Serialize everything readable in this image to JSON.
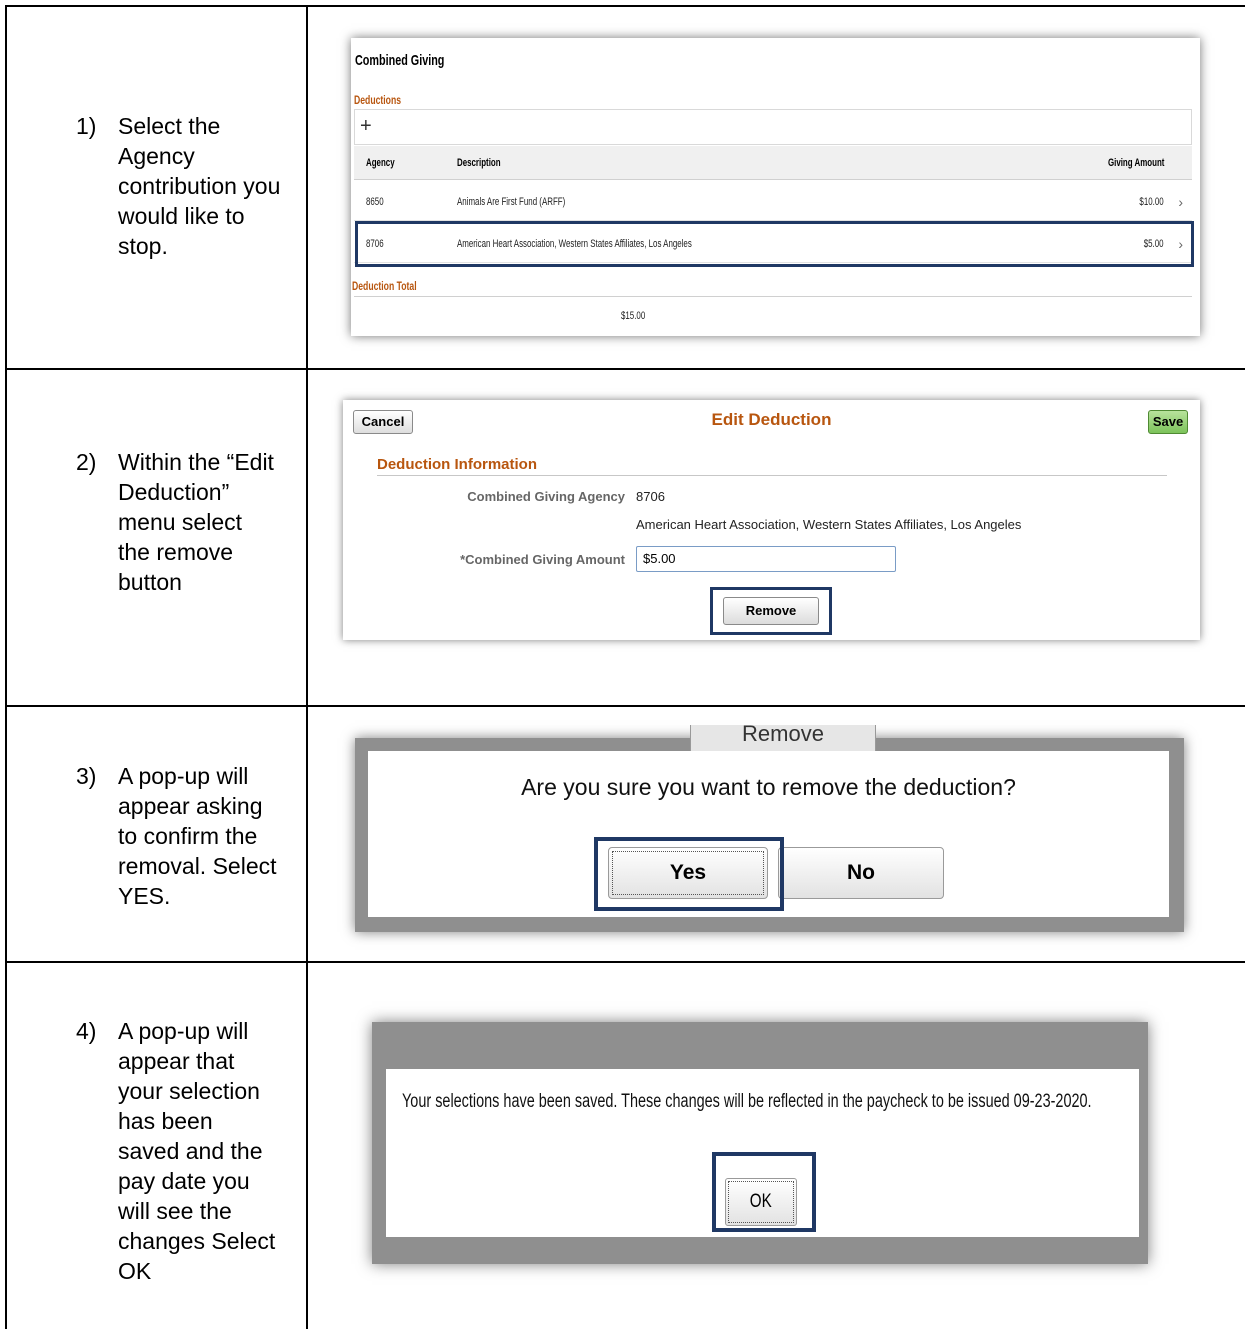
{
  "steps": [
    {
      "num": "1)",
      "text": "Select the Agency contribution you would like to stop."
    },
    {
      "num": "2)",
      "text": "Within the “Edit Deduction” menu select the remove button"
    },
    {
      "num": "3)",
      "text": "A pop-up will appear asking to confirm the removal. Select YES."
    },
    {
      "num": "4)",
      "text": "A pop-up will appear that your selection has been saved and the pay date you will see the changes Select OK"
    }
  ],
  "combined_giving": {
    "title": "Combined Giving",
    "deductions_label": "Deductions",
    "add_icon": "+",
    "columns": {
      "agency": "Agency",
      "description": "Description",
      "amount": "Giving Amount"
    },
    "rows": [
      {
        "agency": "8650",
        "description": "Animals Are First Fund (ARFF)",
        "amount": "$10.00"
      },
      {
        "agency": "8706",
        "description": "American Heart Association, Western States Affiliates, Los Angeles",
        "amount": "$5.00"
      }
    ],
    "deduction_total_label": "Deduction Total",
    "deduction_total": "$15.00"
  },
  "edit_deduction": {
    "cancel": "Cancel",
    "title": "Edit Deduction",
    "save": "Save",
    "section": "Deduction Information",
    "agency_label": "Combined Giving Agency",
    "agency_value": "8706",
    "agency_desc": "American Heart Association, Western States Affiliates, Los Angeles",
    "amount_label": "*Combined Giving Amount",
    "amount_value": "$5.00",
    "remove": "Remove"
  },
  "confirm_popup": {
    "peek": "Remove",
    "question": "Are you sure you want to remove the deduction?",
    "yes": "Yes",
    "no": "No"
  },
  "saved_popup": {
    "message": "Your selections have been saved.  These changes will be reflected in the paycheck to be issued 09-23-2020.",
    "ok": "OK"
  },
  "colors": {
    "accent": "#b8560f",
    "highlight": "#1f3864",
    "save_green": "#7cc35a"
  }
}
